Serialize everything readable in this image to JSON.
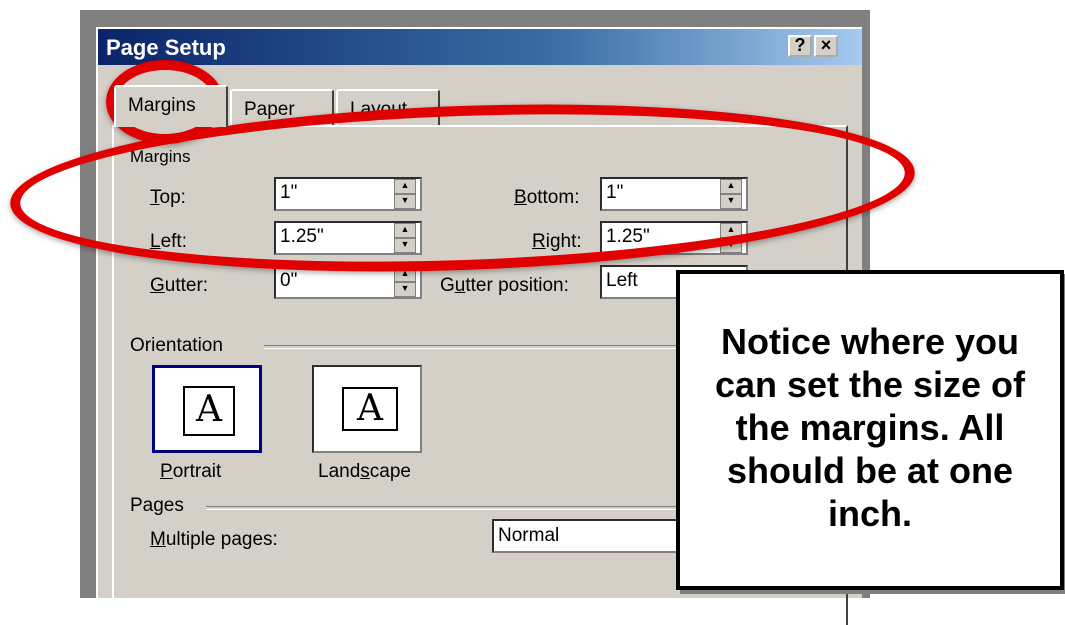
{
  "dialog": {
    "title": "Page Setup",
    "help_label": "?",
    "close_label": "×",
    "tabs": [
      {
        "label": "Margins"
      },
      {
        "label": "Paper"
      },
      {
        "label": "Layout"
      }
    ]
  },
  "margins": {
    "section_label": "Margins",
    "top": {
      "label": "Top:",
      "accesskey": "T",
      "rest": "op:",
      "value": "1\""
    },
    "left": {
      "label": "Left:",
      "accesskey": "L",
      "rest": "eft:",
      "value": "1.25\""
    },
    "gutter": {
      "label": "Gutter:",
      "accesskey": "G",
      "rest": "utter:",
      "value": "0\""
    },
    "bottom": {
      "label": "Bottom:",
      "accesskey": "B",
      "rest": "ottom:",
      "value": "1\""
    },
    "right": {
      "label": "Right:",
      "prefix": "",
      "accesskey": "R",
      "rest": "ight:",
      "value": "1.25\""
    },
    "gutter_position": {
      "label": "Gutter position:",
      "prefix": "G",
      "accesskey": "u",
      "rest": "tter position:",
      "value": "Left"
    }
  },
  "orientation": {
    "section_label": "Orientation",
    "portrait": {
      "label": "Portrait",
      "accesskey": "P",
      "rest": "ortrait",
      "glyph": "A"
    },
    "landscape": {
      "label": "Landscape",
      "prefix": "Land",
      "accesskey": "s",
      "rest": "cape",
      "glyph": "A"
    }
  },
  "pages": {
    "section_label": "Pages",
    "multiple_label": "Multiple pages:",
    "accesskey": "M",
    "rest": "ultiple pages:",
    "multiple_value": "Normal"
  },
  "callout": {
    "text": "Notice where you can set the size of the margins. All should be at one inch."
  },
  "colors": {
    "annotation_red": "#e10000",
    "dialog_face": "#d4d0c8",
    "titlebar": "#0a246a"
  },
  "icons": {
    "spin_up": "▲",
    "spin_down": "▼",
    "dropdown": "▼"
  }
}
